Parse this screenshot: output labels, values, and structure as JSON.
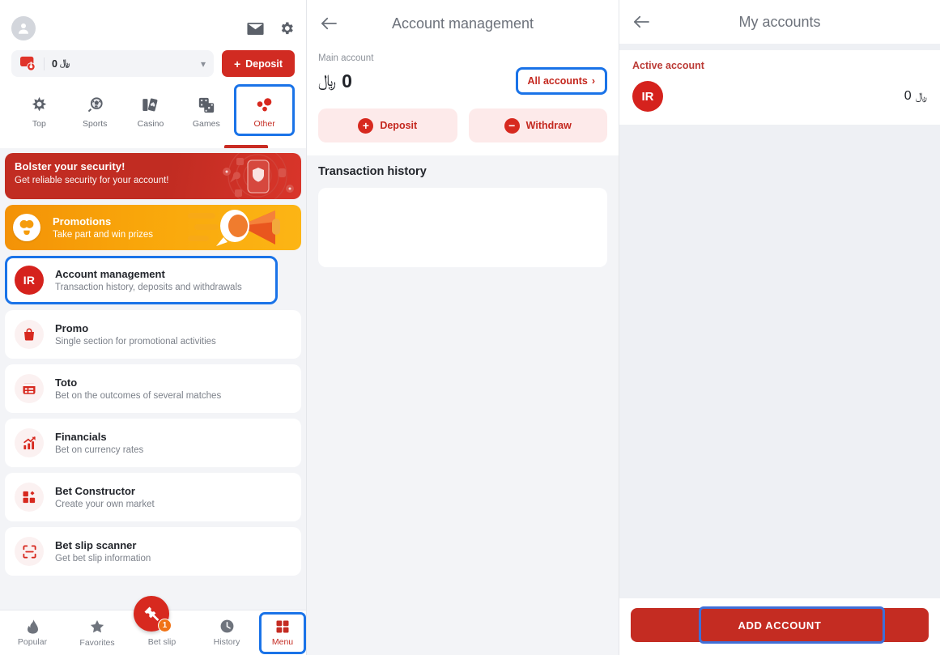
{
  "currency_symbol": "﷼",
  "colors": {
    "brand_red": "#c42c22",
    "accent_orange": "#f9a60a",
    "focus_blue": "#1a73e8",
    "page_bg": "#f3f4f7"
  },
  "left_panel": {
    "header": {
      "avatar_icon": "person-icon",
      "mail_icon": "mail-icon",
      "settings_icon": "gear-icon",
      "balance_value": "0",
      "balance_currency": "﷼",
      "wallet_icon": "wallet-icon",
      "dropdown_icon": "chevron-down-icon",
      "deposit_label": "Deposit",
      "deposit_plus": "+"
    },
    "categories": [
      {
        "label": "Top",
        "icon": "star-burst-icon",
        "selected": false
      },
      {
        "label": "Sports",
        "icon": "soccer-ball-icon",
        "selected": false
      },
      {
        "label": "Casino",
        "icon": "playing-cards-icon",
        "selected": false
      },
      {
        "label": "Games",
        "icon": "dice-icon",
        "selected": false
      },
      {
        "label": "Other",
        "icon": "dots-cluster-icon",
        "selected": true
      }
    ],
    "security_banner": {
      "title": "Bolster your security!",
      "subtitle": "Get reliable security for your account!"
    },
    "promotions_banner": {
      "title": "Promotions",
      "subtitle": "Take part and win prizes",
      "icon": "gift-balloon-icon"
    },
    "menu_items": [
      {
        "title": "Account management",
        "subtitle": "Transaction history, deposits and withdrawals",
        "icon": "IR",
        "highlighted": true
      },
      {
        "title": "Promo",
        "subtitle": "Single section for promotional activities",
        "icon": "shopping-bag-icon",
        "highlighted": false
      },
      {
        "title": "Toto",
        "subtitle": "Bet on the outcomes of several matches",
        "icon": "list-card-icon",
        "highlighted": false
      },
      {
        "title": "Financials",
        "subtitle": "Bet on currency rates",
        "icon": "chart-growth-icon",
        "highlighted": false
      },
      {
        "title": "Bet Constructor",
        "subtitle": "Create your own market",
        "icon": "blocks-icon",
        "highlighted": false
      },
      {
        "title": "Bet slip scanner",
        "subtitle": "Get bet slip information",
        "icon": "scan-frame-icon",
        "highlighted": false
      }
    ],
    "bottom_nav": [
      {
        "label": "Popular",
        "icon": "flame-icon",
        "selected": false
      },
      {
        "label": "Favorites",
        "icon": "star-icon",
        "selected": false
      },
      {
        "label": "Bet slip",
        "icon": "ticket-icon",
        "selected": false,
        "badge": "1"
      },
      {
        "label": "History",
        "icon": "clock-icon",
        "selected": false
      },
      {
        "label": "Menu",
        "icon": "grid-squares-icon",
        "selected": true
      }
    ]
  },
  "mid_panel": {
    "back_icon": "back-arrow-icon",
    "title": "Account management",
    "main_account_label": "Main account",
    "balance_value": "0",
    "balance_currency": "﷼",
    "all_accounts_label": "All accounts",
    "all_accounts_chevron": "›",
    "deposit_label": "Deposit",
    "deposit_icon": "plus-circle-icon",
    "withdraw_label": "Withdraw",
    "withdraw_icon": "minus-circle-icon",
    "transaction_history_title": "Transaction history"
  },
  "right_panel": {
    "back_icon": "back-arrow-icon",
    "title": "My accounts",
    "active_account_label": "Active account",
    "account_badge": "IR",
    "account_balance": "0",
    "account_currency": "﷼",
    "add_account_label": "ADD ACCOUNT"
  }
}
